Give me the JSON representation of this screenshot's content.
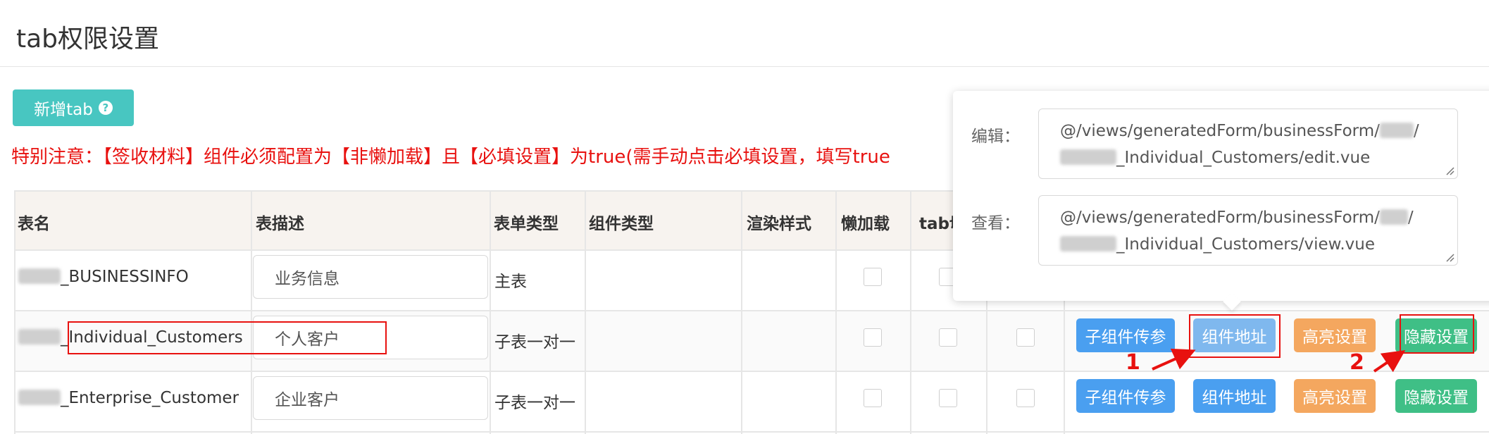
{
  "page": {
    "title": "tab权限设置"
  },
  "toolbar": {
    "add_tab_label": "新增tab",
    "help_icon_glyph": "?"
  },
  "notice": "特别注意：【签收材料】组件必须配置为【非懒加载】且【必填设置】为true(需手动点击必填设置，填写true",
  "table": {
    "headers": [
      "表名",
      "表描述",
      "表单类型",
      "组件类型",
      "渲染样式",
      "懒加载",
      "tab切"
    ],
    "rows": [
      {
        "name_suffix": "_BUSINESSINFO",
        "description": "业务信息",
        "form_type": "主表"
      },
      {
        "name_suffix": "_Individual_Customers",
        "description": "个人客户",
        "form_type": "子表一对一"
      },
      {
        "name_suffix": "_Enterprise_Customer",
        "description": "企业客户",
        "form_type": "子表一对一"
      }
    ],
    "actions": {
      "child_params": "子组件传参",
      "component_address": "组件地址",
      "highlight_settings": "高亮设置",
      "hide_settings": "隐藏设置"
    }
  },
  "popover": {
    "edit_label": "编辑：",
    "edit_line1_prefix": "@/views/generatedForm/businessForm/",
    "edit_line1_suffix": "/",
    "edit_line2_suffix": "_Individual_Customers/edit.vue",
    "view_label": "查看：",
    "view_line1_prefix": "@/views/generatedForm/businessForm/",
    "view_line1_suffix": "/",
    "view_line2_suffix": "_Individual_Customers/view.vue"
  },
  "annotations": {
    "step1": "1",
    "step2": "2"
  },
  "colors": {
    "accent": "#48c6c1",
    "notice": "#e8110f",
    "blue": "#4a9ff0",
    "orange": "#f4a75f",
    "green": "#3fbf86"
  }
}
